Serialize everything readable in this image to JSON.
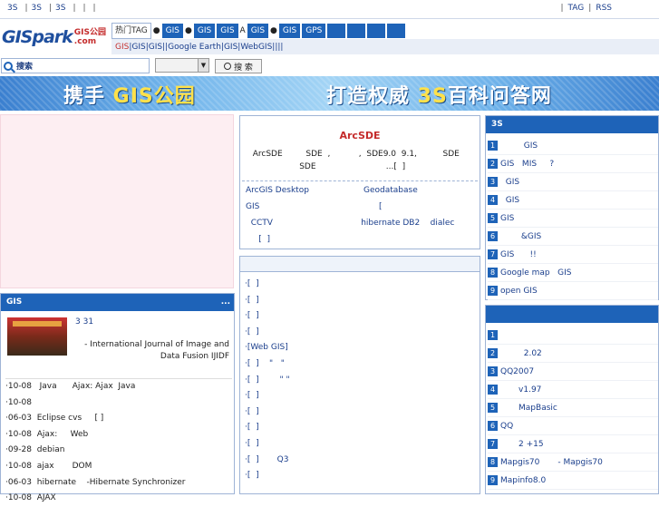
{
  "topbar": {
    "left": [
      "3S",
      "|",
      "3S",
      "|",
      "3S",
      "|",
      "|",
      "|"
    ],
    "right": [
      "|",
      "TAG",
      "|",
      "RSS"
    ]
  },
  "logo": {
    "main": "GISpark",
    "sub1": "GIS公园",
    "sub2": ".com"
  },
  "nav": {
    "tag": "热门TAG",
    "items": [
      "GIS",
      "GIS",
      "GIS",
      "GIS",
      "GIS",
      "GPS",
      "",
      "",
      "",
      ""
    ],
    "dots": [
      "●",
      "●",
      "A",
      "●",
      "●"
    ]
  },
  "subnav": [
    "GIS",
    "|",
    "",
    "GIS|",
    "GIS|",
    "",
    "|Google Earth|",
    "GIS|",
    "WebGIS|",
    "",
    "|",
    "|",
    "|"
  ],
  "search": {
    "placeholder": "搜索",
    "button": "搜 索",
    "select_value": ""
  },
  "banner": {
    "text1a": "携手 ",
    "text1b": "GIS公园",
    "text2a": "打造权威 ",
    "text2b": "3S",
    "text2c": "百科问答网"
  },
  "gis_news": {
    "title": "GIS",
    "more": "...",
    "feature_title": "3 31",
    "feature_desc": "- International Journal of Image and Data Fusion  IJIDF",
    "list": [
      "·10-08   Java      Ajax: Ajax  Java",
      "·10-08",
      "·06-03  Eclipse cvs     [ ]",
      "·10-08  Ajax:     Web",
      "·09-28  debian",
      "·10-08  ajax       DOM",
      "·06-03  hibernate    -Hibernate Synchronizer",
      "·10-08  AJAX"
    ]
  },
  "center_top": {
    "title": "ArcSDE",
    "body": "  ArcSDE         SDE  ,           ,  SDE9.0  9.1,          SDE\n                    SDE                           ...[  ]",
    "links": "ArcGIS Desktop                     Geodatabase\nGIS                                              [\n  CCTV                                  hibernate DB2    dialec\n     [  ]"
  },
  "center_bottom": {
    "list": [
      "·[  ]",
      "·[  ]",
      "·[  ]",
      "·[  ]",
      "·[Web GIS]",
      "·[  ]    \"   \"",
      "·[  ]        \" \"",
      "·[  ]",
      "·[  ]",
      "·[  ]",
      "·[  ]",
      "·[  ]       Q3",
      "·[  ]"
    ]
  },
  "right_top": {
    "title": "3S",
    "items": [
      {
        "n": "1",
        "t": "         GIS"
      },
      {
        "n": "2",
        "t": "GIS   MIS     ?"
      },
      {
        "n": "3",
        "t": "  GIS"
      },
      {
        "n": "4",
        "t": "  GIS"
      },
      {
        "n": "5",
        "t": "GIS"
      },
      {
        "n": "6",
        "t": "        &GIS"
      },
      {
        "n": "7",
        "t": "GIS      !!"
      },
      {
        "n": "8",
        "t": "Google map   GIS"
      },
      {
        "n": "9",
        "t": "open GIS"
      }
    ]
  },
  "right_bottom": {
    "title": "",
    "items": [
      {
        "n": "1",
        "t": ""
      },
      {
        "n": "2",
        "t": "         2.02"
      },
      {
        "n": "3",
        "t": "QQ2007"
      },
      {
        "n": "4",
        "t": "       v1.97"
      },
      {
        "n": "5",
        "t": "       MapBasic"
      },
      {
        "n": "6",
        "t": "QQ"
      },
      {
        "n": "7",
        "t": "       2 +15"
      },
      {
        "n": "8",
        "t": "Mapgis70       - Mapgis70"
      },
      {
        "n": "9",
        "t": "Mapinfo8.0"
      }
    ]
  }
}
